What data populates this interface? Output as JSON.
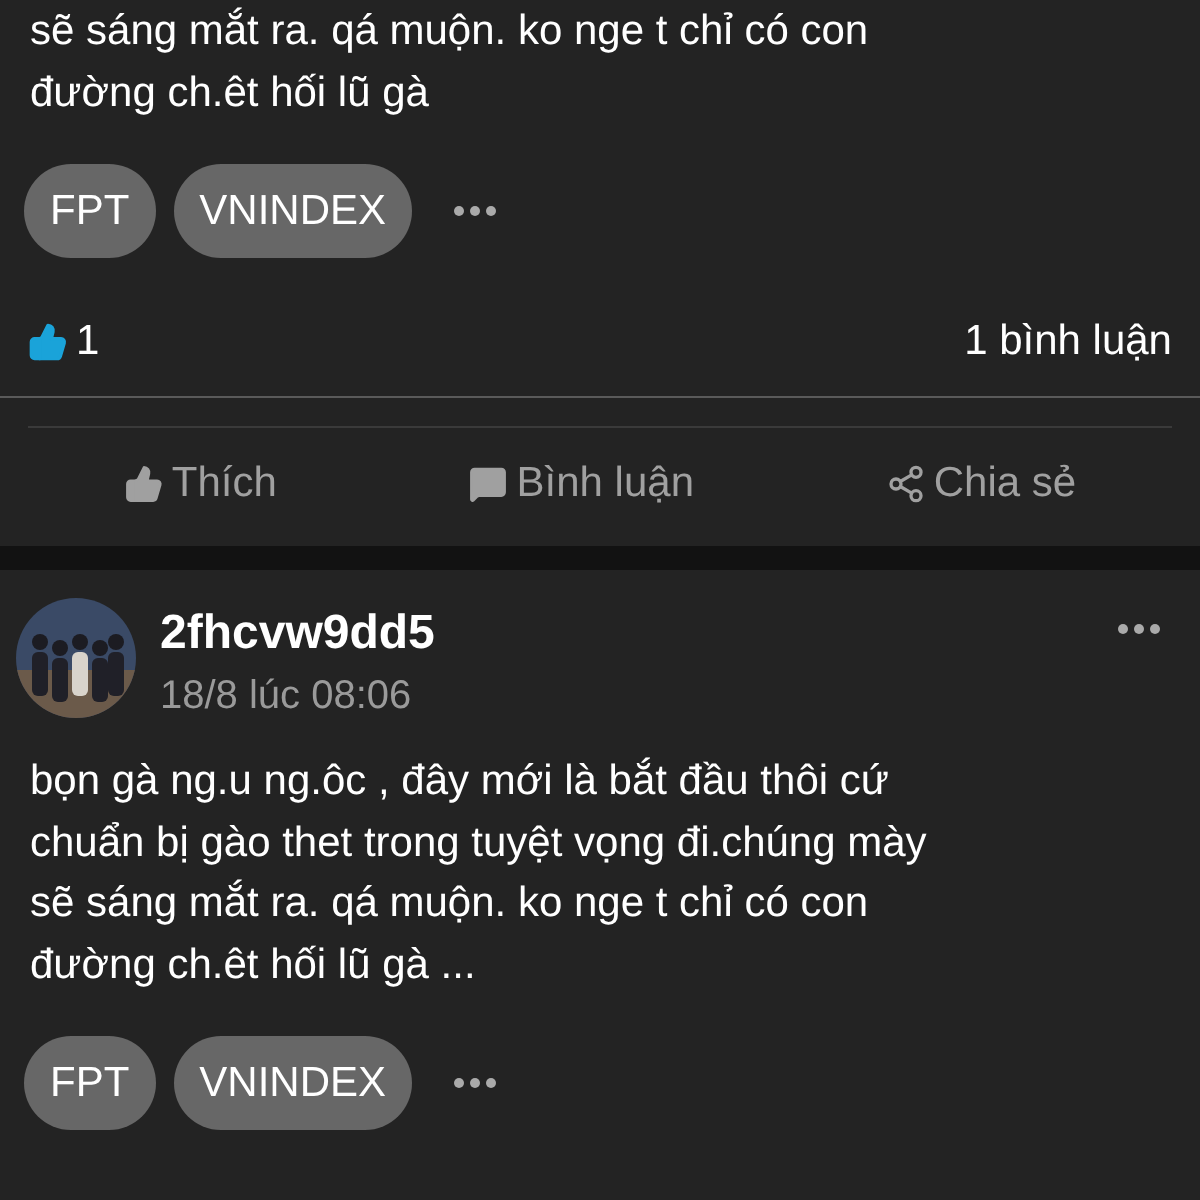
{
  "posts": [
    {
      "text_lines": [
        "sẽ sáng mắt ra. qá muộn. ko nge t chỉ có con",
        "đường ch.êt hối lũ gà"
      ],
      "tags": [
        "FPT",
        "VNINDEX"
      ],
      "likes": "1",
      "comments": "1 bình luận",
      "actions": [
        {
          "kind": "like",
          "label": "Thích"
        },
        {
          "kind": "comment",
          "label": "Bình luận"
        },
        {
          "kind": "share",
          "label": "Chia sẻ"
        }
      ]
    },
    {
      "author": "2fhcvw9dd5",
      "time": "18/8 lúc 08:06",
      "avatar": {
        "kind": "picture"
      },
      "text_lines": [
        "bọn gà ng.u ng.ôc , đây mới là bắt đầu thôi cứ",
        "chuẩn bị gào thet trong tuyệt vọng đi.chúng mày",
        "sẽ sáng mắt ra. qá muộn. ko nge t chỉ có con",
        "đường ch.êt hối lũ gà ..."
      ],
      "tags": [
        "FPT",
        "VNINDEX"
      ]
    }
  ]
}
